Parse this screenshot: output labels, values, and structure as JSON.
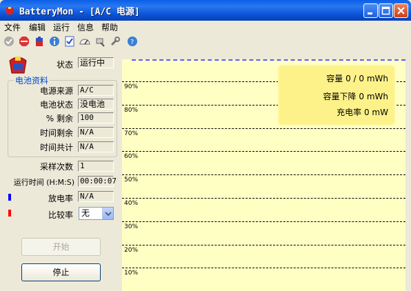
{
  "window": {
    "title": "BatteryMon - [A/C 电源]"
  },
  "menu": [
    "文件",
    "编辑",
    "运行",
    "信息",
    "帮助"
  ],
  "toolbar_icons": [
    "check-icon",
    "stop-icon",
    "battery-icon",
    "info-icon",
    "checklist-icon",
    "gauge-icon",
    "tool-icon",
    "wrench-icon",
    "help-icon"
  ],
  "status": {
    "label": "状态",
    "value": "运行中"
  },
  "battery_group": {
    "title": "电池资料",
    "fields": [
      {
        "label": "电源来源",
        "value": "A/C"
      },
      {
        "label": "电池状态",
        "value": "没电池"
      },
      {
        "label": "% 剩余",
        "value": "100"
      },
      {
        "label": "时间剩余",
        "value": "N/A"
      },
      {
        "label": "时间共计",
        "value": "N/A"
      }
    ]
  },
  "samples": {
    "label": "采样次数",
    "value": "1"
  },
  "runtime": {
    "label": "运行时间 (H:M:S)",
    "value": "00:00:07"
  },
  "discharge": {
    "label": "放电率",
    "value": "N/A",
    "color": "#0000ff"
  },
  "compare": {
    "label": "比较率",
    "value": "无",
    "color": "#ff0000"
  },
  "buttons": {
    "start": "开始",
    "stop": "停止"
  },
  "chart_data": {
    "type": "line",
    "y_ticks": [
      "90%",
      "80%",
      "70%",
      "60%",
      "50%",
      "40%",
      "30%",
      "20%",
      "10%"
    ],
    "ylim": [
      0,
      100
    ],
    "series": [],
    "legend": [
      {
        "label": "容量",
        "value": "0 / 0 mWh"
      },
      {
        "label": "容量下降",
        "value": "0 mWh"
      },
      {
        "label": "充电率",
        "value": "0 mW"
      }
    ],
    "background": "#ffffc4"
  }
}
